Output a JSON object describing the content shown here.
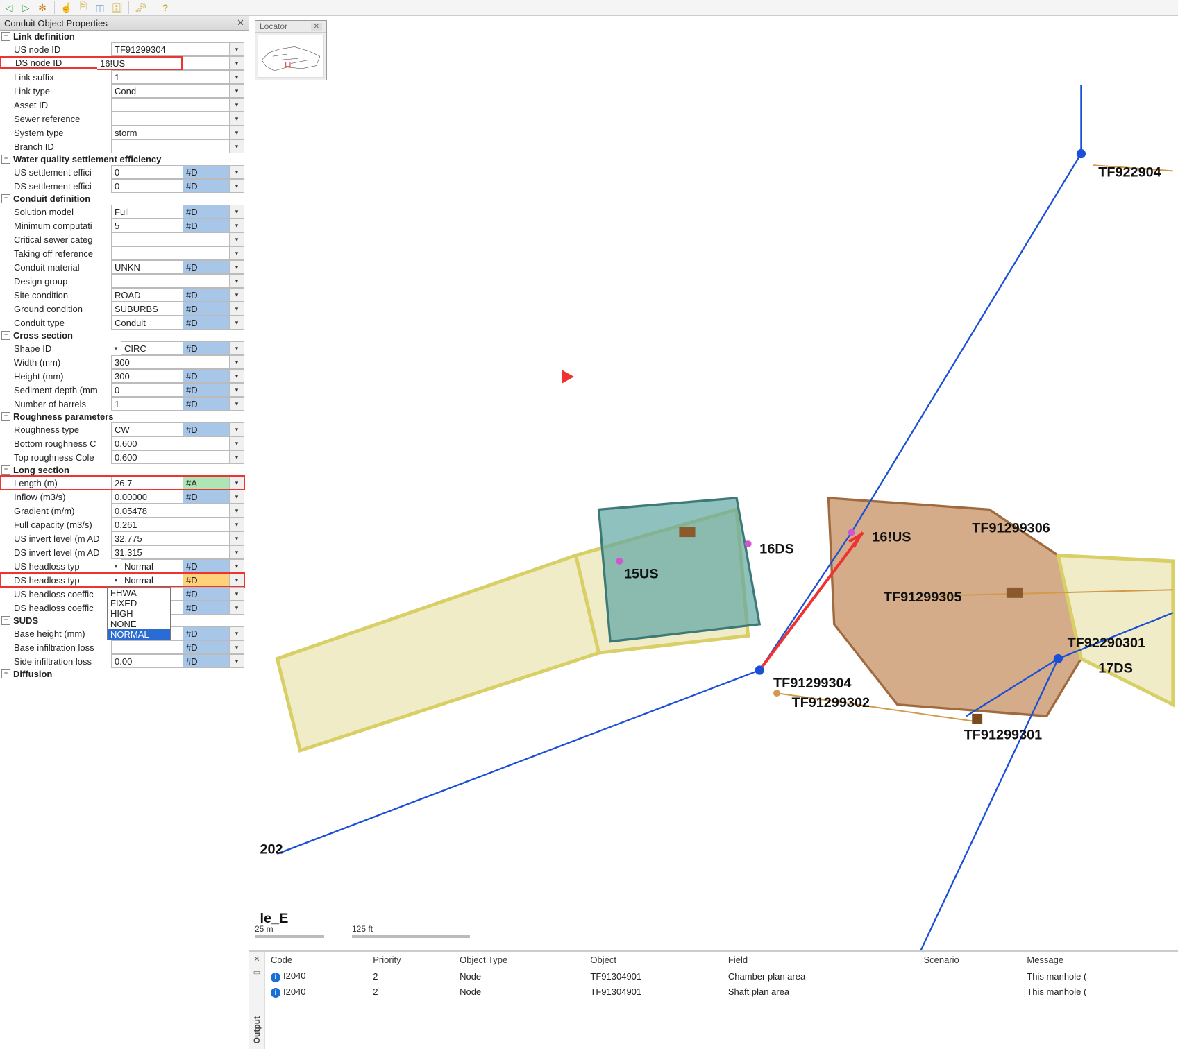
{
  "toolbar_icons": [
    "◁",
    "▷",
    "✻",
    "|",
    "☝",
    "🗎",
    "◫",
    "🗄",
    "|",
    "🔑",
    "|",
    "?"
  ],
  "panel_title": "Conduit Object Properties",
  "sections": [
    {
      "name": "Link definition",
      "rows": [
        {
          "label": "US node ID",
          "value": "TF91299304",
          "flag": "",
          "pick": true
        },
        {
          "label": "DS node ID",
          "value": "16!US",
          "flag": "",
          "pick": true,
          "highlight": true
        },
        {
          "label": "Link suffix",
          "value": "1",
          "flag": "",
          "pick": true
        },
        {
          "label": "Link type",
          "value": "Cond",
          "flag": "",
          "pick": true
        },
        {
          "label": "Asset ID",
          "value": "",
          "flag": "",
          "pick": true
        },
        {
          "label": "Sewer reference",
          "value": "",
          "flag": "",
          "pick": true
        },
        {
          "label": "System type",
          "value": "storm",
          "flag": "",
          "pick": true
        },
        {
          "label": "Branch ID",
          "value": "",
          "flag": "",
          "pick": true
        }
      ]
    },
    {
      "name": "Water quality settlement efficiency",
      "rows": [
        {
          "label": "US settlement effici",
          "value": "0",
          "flag": "#D",
          "flagClass": "d",
          "pick": true
        },
        {
          "label": "DS settlement effici",
          "value": "0",
          "flag": "#D",
          "flagClass": "d",
          "pick": true
        }
      ]
    },
    {
      "name": "Conduit definition",
      "rows": [
        {
          "label": "Solution model",
          "value": "Full",
          "flag": "#D",
          "flagClass": "d",
          "pick": true
        },
        {
          "label": "Minimum computati",
          "value": "5",
          "flag": "#D",
          "flagClass": "d",
          "pick": true
        },
        {
          "label": "Critical sewer categ",
          "value": "",
          "flag": "",
          "pick": true
        },
        {
          "label": "Taking off reference",
          "value": "",
          "flag": "",
          "pick": true
        },
        {
          "label": "Conduit material",
          "value": "UNKN",
          "flag": "#D",
          "flagClass": "d",
          "pick": true
        },
        {
          "label": "Design group",
          "value": "",
          "flag": "",
          "pick": true
        },
        {
          "label": "Site condition",
          "value": "ROAD",
          "flag": "#D",
          "flagClass": "d",
          "pick": true
        },
        {
          "label": "Ground condition",
          "value": "SUBURBS",
          "flag": "#D",
          "flagClass": "d",
          "pick": true
        },
        {
          "label": "Conduit type",
          "value": "Conduit",
          "flag": "#D",
          "flagClass": "d",
          "pick": true
        }
      ]
    },
    {
      "name": "Cross section",
      "rows": [
        {
          "label": "Shape ID",
          "sub": true,
          "value": "CIRC",
          "flag": "#D",
          "flagClass": "d",
          "pick": true
        },
        {
          "label": "Width (mm)",
          "value": "300",
          "flag": "",
          "pick": true
        },
        {
          "label": "Height (mm)",
          "value": "300",
          "flag": "#D",
          "flagClass": "d",
          "pick": true
        },
        {
          "label": "Sediment depth (mm",
          "value": "0",
          "flag": "#D",
          "flagClass": "d",
          "pick": true
        },
        {
          "label": "Number of barrels",
          "value": "1",
          "flag": "#D",
          "flagClass": "d",
          "pick": true
        }
      ]
    },
    {
      "name": "Roughness parameters",
      "rows": [
        {
          "label": "Roughness type",
          "value": "CW",
          "flag": "#D",
          "flagClass": "d",
          "pick": true
        },
        {
          "label": "Bottom roughness C",
          "value": "0.600",
          "flag": "",
          "pick": true
        },
        {
          "label": "Top roughness Cole",
          "value": "0.600",
          "flag": "",
          "pick": true
        }
      ]
    },
    {
      "name": "Long section",
      "rows": [
        {
          "label": "Length (m)",
          "value": "26.7",
          "flag": "#A",
          "flagClass": "a",
          "pick": true,
          "highlightFull": true
        },
        {
          "label": "Inflow (m3/s)",
          "value": "0.00000",
          "flag": "#D",
          "flagClass": "d",
          "pick": true
        },
        {
          "label": "Gradient (m/m)",
          "value": "0.05478",
          "flag": "",
          "pick": true
        },
        {
          "label": "Full capacity (m3/s)",
          "value": "0.261",
          "flag": "",
          "pick": true
        },
        {
          "label": "US invert level (m AD",
          "value": "32.775",
          "flag": "",
          "pick": true
        },
        {
          "label": "DS invert level (m AD",
          "value": "31.315",
          "flag": "",
          "pick": true
        },
        {
          "label": "US headloss typ",
          "sub": true,
          "value": "Normal",
          "flag": "#D",
          "flagClass": "d",
          "pick": true
        },
        {
          "label": "DS headloss typ",
          "sub": true,
          "value": "Normal",
          "flag": "#D",
          "flagClass": "sel",
          "pick": true,
          "highlightFull": true,
          "dropdown": [
            "FHWA",
            "FIXED",
            "HIGH",
            "NONE",
            "NORMAL"
          ]
        },
        {
          "label": "US headloss coeffic",
          "value": "",
          "flag": "#D",
          "flagClass": "d",
          "pick": true
        },
        {
          "label": "DS headloss coeffic",
          "value": "",
          "flag": "#D",
          "flagClass": "d",
          "pick": true
        }
      ]
    },
    {
      "name": "SUDS",
      "rows": [
        {
          "label": "Base height (mm)",
          "value": "",
          "flag": "#D",
          "flagClass": "d",
          "pick": true
        },
        {
          "label": "Base infiltration loss",
          "value": "",
          "flag": "#D",
          "flagClass": "d",
          "pick": true
        },
        {
          "label": "Side infiltration loss",
          "value": "0.00",
          "flag": "#D",
          "flagClass": "d",
          "pick": true
        }
      ]
    },
    {
      "name": "Diffusion",
      "rows": []
    }
  ],
  "dropdown_selected": "NORMAL",
  "locator_title": "Locator",
  "scale_left": "25 m",
  "scale_right": "125 ft",
  "map_labels": {
    "tf922904": "TF922904",
    "l15us": "15US",
    "l16ds": "16DS",
    "l16us": "16!US",
    "tf91299306": "TF91299306",
    "tf91299305": "TF91299305",
    "tf92290301": "TF92290301",
    "l17ds": "17DS",
    "tf91299304": "TF91299304",
    "tf91299302": "TF91299302",
    "tf91299301": "TF91299301",
    "l202": "202",
    "le": "le_E"
  },
  "messages": {
    "headers": [
      "Code",
      "Priority",
      "Object Type",
      "Object",
      "Field",
      "Scenario",
      "Message"
    ],
    "rows": [
      {
        "code": "I2040",
        "priority": "2",
        "objtype": "Node",
        "object": "TF91304901",
        "field": "Chamber plan area",
        "scenario": "",
        "message": "This manhole ("
      },
      {
        "code": "I2040",
        "priority": "2",
        "objtype": "Node",
        "object": "TF91304901",
        "field": "Shaft plan area",
        "scenario": "",
        "message": "This manhole ("
      }
    ]
  },
  "output_tab": "Output"
}
